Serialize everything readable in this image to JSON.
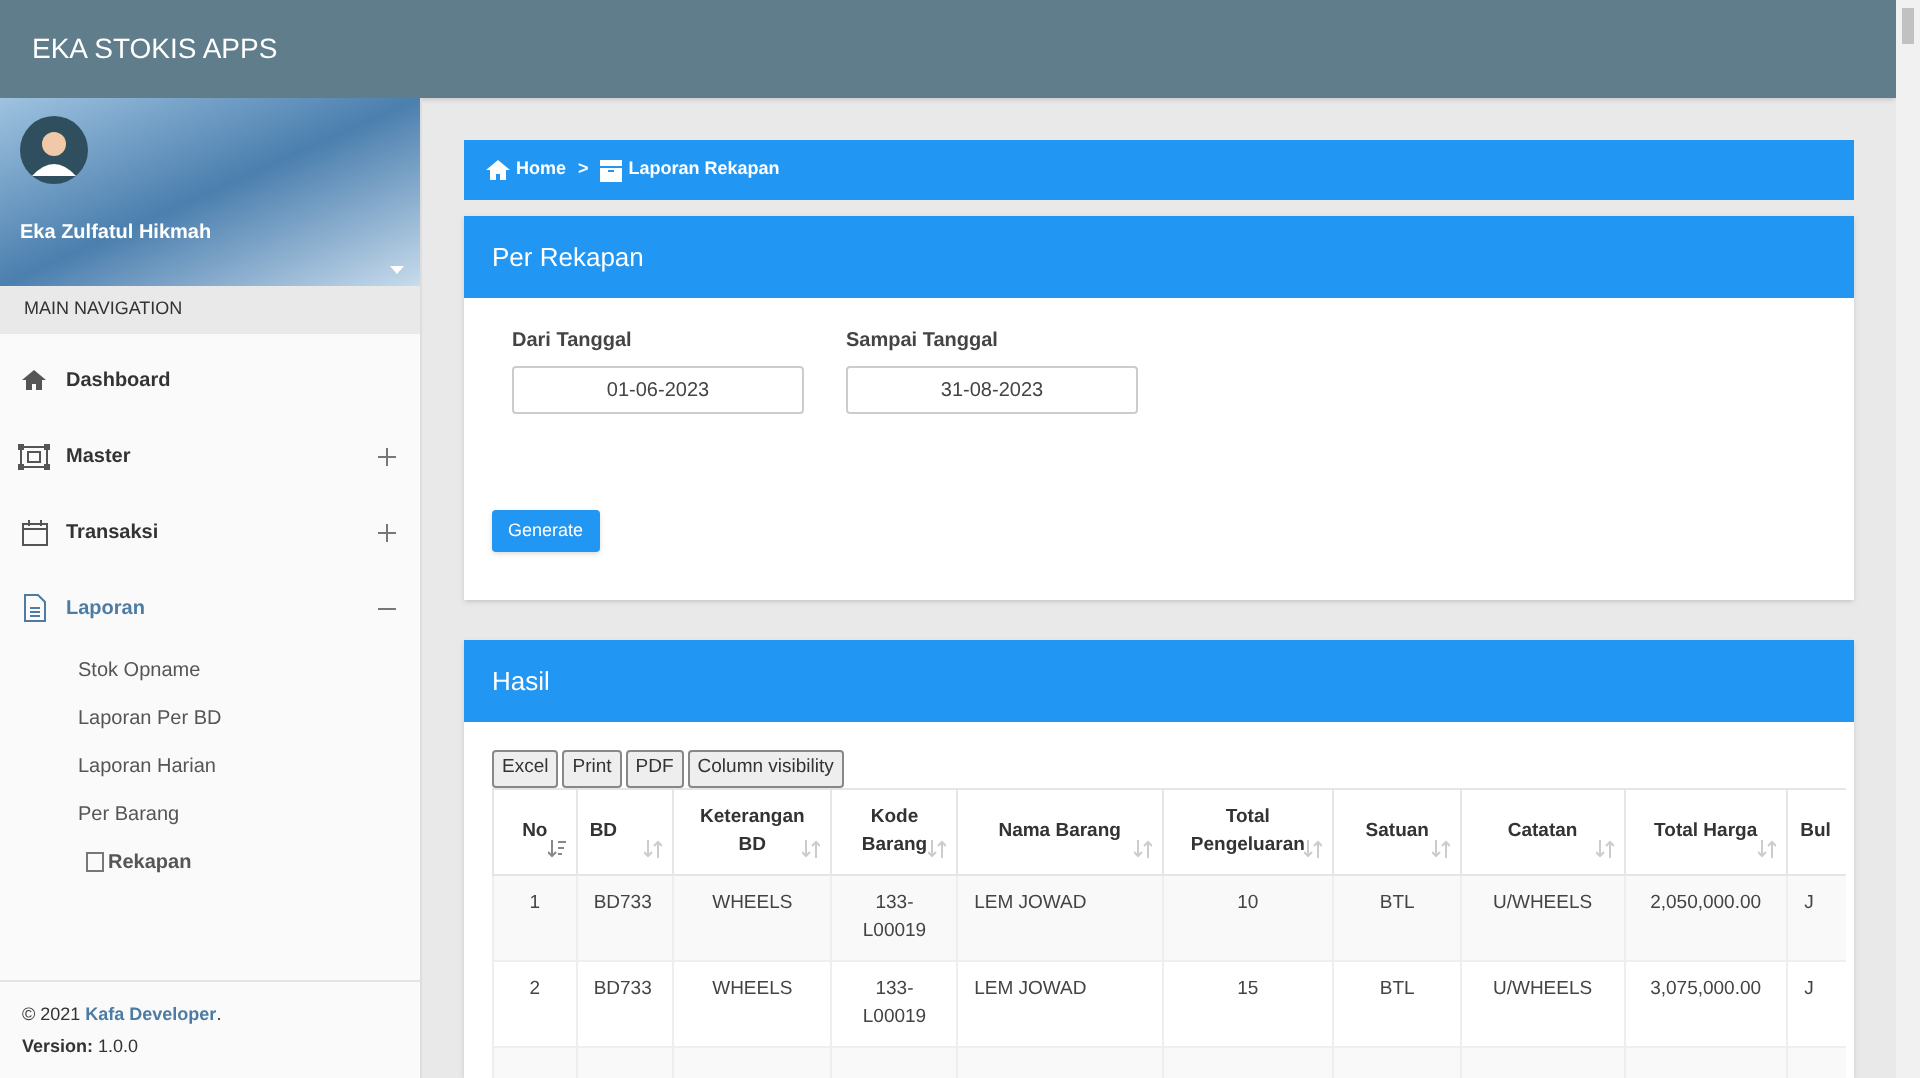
{
  "app_title": "EKA STOKIS APPS",
  "user": {
    "name": "Eka Zulfatul Hikmah"
  },
  "nav_header": "MAIN NAVIGATION",
  "sidebar": {
    "items": [
      {
        "label": "Dashboard",
        "selected": false
      },
      {
        "label": "Master",
        "expanded": false,
        "selected": false
      },
      {
        "label": "Transaksi",
        "expanded": false,
        "selected": false
      },
      {
        "label": "Laporan",
        "expanded": true,
        "selected": true,
        "children": [
          {
            "label": "Stok Opname",
            "kind": "link"
          },
          {
            "label": "Laporan Per BD",
            "kind": "link"
          },
          {
            "label": "Laporan Harian",
            "kind": "link"
          },
          {
            "label": "Per Barang",
            "kind": "link"
          },
          {
            "label": "Rekapan",
            "kind": "checkbox"
          }
        ]
      }
    ]
  },
  "footer": {
    "copyright": "© 2021",
    "brand": "Kafa Developer",
    "period": ".",
    "version_label": "Version:",
    "version": "1.0.0"
  },
  "breadcrumb": [
    {
      "label": "Home",
      "kind": "link"
    },
    {
      "label": ">",
      "kind": "separator"
    },
    {
      "label": "Laporan Rekapan",
      "kind": "current"
    }
  ],
  "form_panel": {
    "title": "Per Rekapan",
    "fields": [
      {
        "label": "Dari Tanggal",
        "value": "01-06-2023"
      },
      {
        "label": "Sampai Tanggal",
        "value": "31-08-2023"
      }
    ],
    "button": "Generate"
  },
  "result_panel": {
    "title": "Hasil",
    "buttons": [
      "Excel",
      "Print",
      "PDF",
      "Column visibility"
    ],
    "table": {
      "columns": [
        {
          "label": "No",
          "sorted": true
        },
        {
          "label": "BD",
          "sorted": false
        },
        {
          "label": "Keterangan BD",
          "sorted": false
        },
        {
          "label": "Kode Barang",
          "sorted": false
        },
        {
          "label": "Nama Barang",
          "sorted": false
        },
        {
          "label": "Total Pengeluaran",
          "sorted": false
        },
        {
          "label": "Satuan",
          "sorted": false
        },
        {
          "label": "Catatan",
          "sorted": false
        },
        {
          "label": "Total Harga",
          "sorted": false
        },
        {
          "label": "Bul"
        }
      ],
      "rows": [
        {
          "cells": [
            "1",
            "BD733",
            "WHEELS",
            "133-L00019",
            "LEM JOWAD",
            "10",
            "BTL",
            "U/WHEELS",
            "2,050,000.00",
            "J"
          ]
        },
        {
          "cells": [
            "2",
            "BD733",
            "WHEELS",
            "133-L00019",
            "LEM JOWAD",
            "15",
            "BTL",
            "U/WHEELS",
            "3,075,000.00",
            "J"
          ]
        }
      ]
    }
  }
}
